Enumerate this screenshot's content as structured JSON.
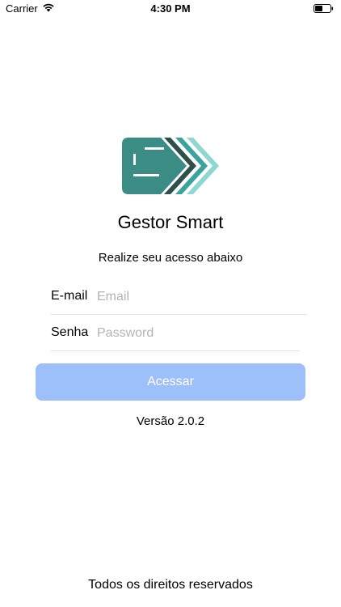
{
  "status_bar": {
    "carrier": "Carrier",
    "time": "4:30 PM",
    "wifi_icon": "wifi-icon",
    "battery_icon": "battery-icon"
  },
  "logo": {
    "icon": "gestor-smart-logo",
    "colors": [
      "#3a8c85",
      "#2f4f4d",
      "#3aa39c",
      "#49c7bd",
      "#8fd8d2"
    ]
  },
  "app_title": "Gestor Smart",
  "subtitle": "Realize seu acesso abaixo",
  "form": {
    "email_label": "E-mail",
    "email_placeholder": "Email",
    "email_value": "",
    "password_label": "Senha",
    "password_placeholder": "Password",
    "password_value": ""
  },
  "login_button": {
    "label": "Acessar",
    "color": "#9cc0f7"
  },
  "version": "Versão 2.0.2",
  "footer": "Todos os direitos reservados"
}
